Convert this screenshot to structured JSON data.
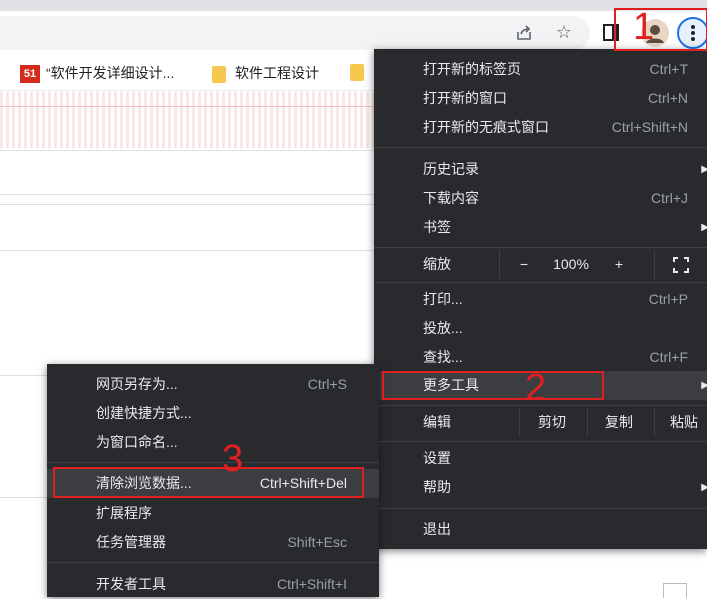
{
  "browser": {
    "toolbar_icons": [
      "share-icon",
      "star-icon",
      "sidepanel-icon",
      "profile-icon",
      "more-menu-icon"
    ],
    "bookmarks": [
      {
        "label": "“软件开发详细设计...",
        "icon": "51cto-logo-icon"
      },
      {
        "label": "软件工程设计",
        "icon": "folder-icon"
      }
    ],
    "logo_text": "51"
  },
  "main_menu": {
    "new_tab": {
      "label": "打开新的标签页",
      "shortcut": "Ctrl+T"
    },
    "new_window": {
      "label": "打开新的窗口",
      "shortcut": "Ctrl+N"
    },
    "incognito": {
      "label": "打开新的无痕式窗口",
      "shortcut": "Ctrl+Shift+N"
    },
    "history": {
      "label": "历史记录"
    },
    "downloads": {
      "label": "下载内容",
      "shortcut": "Ctrl+J"
    },
    "bookmarks": {
      "label": "书签"
    },
    "zoom": {
      "label": "缩放",
      "minus": "−",
      "value": "100%",
      "plus": "+"
    },
    "print": {
      "label": "打印...",
      "shortcut": "Ctrl+P"
    },
    "cast": {
      "label": "投放..."
    },
    "find": {
      "label": "查找...",
      "shortcut": "Ctrl+F"
    },
    "more_tools": {
      "label": "更多工具"
    },
    "edit": {
      "label": "编辑",
      "cut": "剪切",
      "copy": "复制",
      "paste": "粘贴"
    },
    "settings": {
      "label": "设置"
    },
    "help": {
      "label": "帮助"
    },
    "exit": {
      "label": "退出"
    }
  },
  "sub_menu": {
    "save_page": {
      "label": "网页另存为...",
      "shortcut": "Ctrl+S"
    },
    "create_shortcut": {
      "label": "创建快捷方式..."
    },
    "name_window": {
      "label": "为窗口命名..."
    },
    "clear_data": {
      "label": "清除浏览数据...",
      "shortcut": "Ctrl+Shift+Del"
    },
    "extensions": {
      "label": "扩展程序"
    },
    "task_manager": {
      "label": "任务管理器",
      "shortcut": "Shift+Esc"
    },
    "dev_tools": {
      "label": "开发者工具",
      "shortcut": "Ctrl+Shift+I"
    }
  },
  "annotations": {
    "step1": "1",
    "step2": "2",
    "step3": "3",
    "color": "#e02020"
  },
  "colors": {
    "menu_bg": "#292a2d",
    "menu_text": "#e8eaed",
    "highlight": "#3c3d40"
  }
}
